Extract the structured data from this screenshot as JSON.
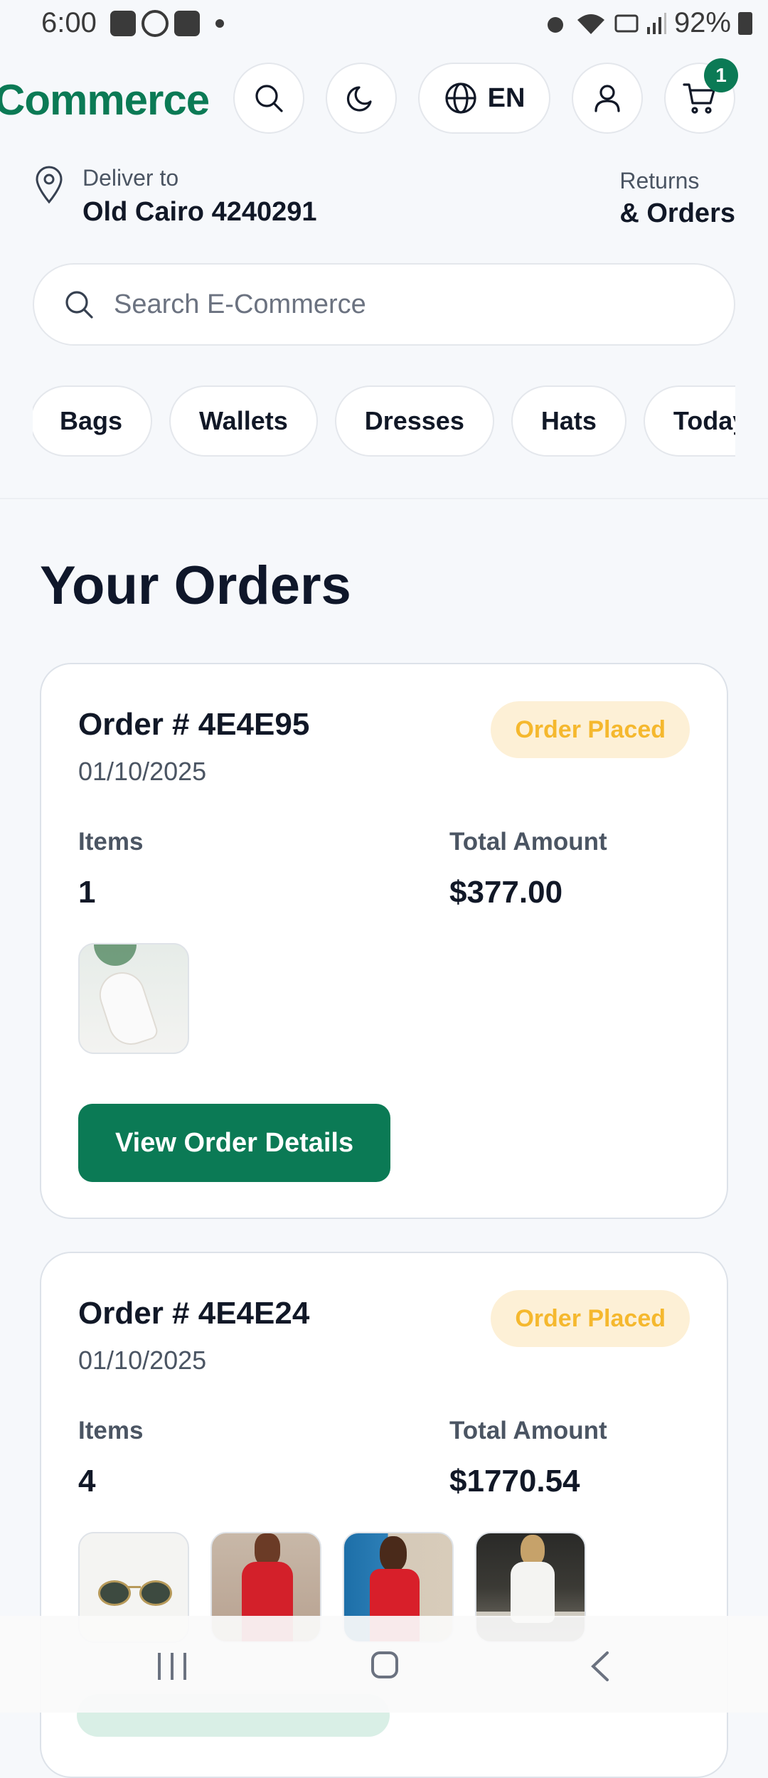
{
  "status_bar": {
    "time": "6:00",
    "battery": "92%"
  },
  "header": {
    "brand": "Commerce",
    "language": "EN",
    "cart_count": "1"
  },
  "delivery": {
    "label": "Deliver to",
    "address": "Old Cairo 4240291",
    "returns_label": "Returns",
    "orders_label": "& Orders"
  },
  "search": {
    "placeholder": "Search E-Commerce"
  },
  "categories": [
    "Bags",
    "Wallets",
    "Dresses",
    "Hats",
    "Today's"
  ],
  "page_title": "Your Orders",
  "orders": [
    {
      "number": "Order # 4E4E95",
      "date": "01/10/2025",
      "status": "Order Placed",
      "items_label": "Items",
      "items": "1",
      "total_label": "Total Amount",
      "total": "$377.00",
      "thumbnails": [
        "white-heels-image"
      ],
      "button": "View Order Details"
    },
    {
      "number": "Order # 4E4E24",
      "date": "01/10/2025",
      "status": "Order Placed",
      "items_label": "Items",
      "items": "4",
      "total_label": "Total Amount",
      "total": "$1770.54",
      "thumbnails": [
        "sunglasses-image",
        "red-dress-image",
        "red-dress-image",
        "white-dress-image"
      ]
    }
  ],
  "colors": {
    "brand": "#0b7a55",
    "badge_bg": "#fdf0d6",
    "badge_text": "#f5b82e"
  }
}
